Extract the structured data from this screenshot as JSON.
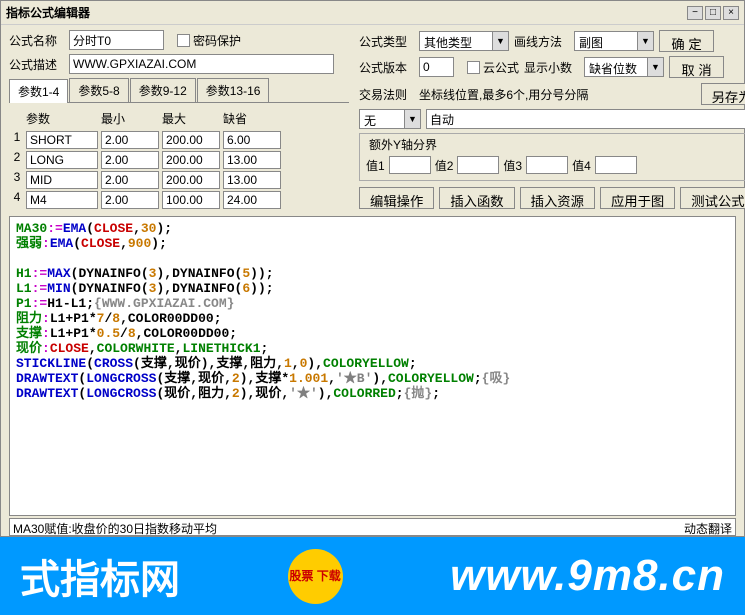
{
  "title": "指标公式编辑器",
  "form": {
    "name_label": "公式名称",
    "name_value": "分时T0",
    "pwd_protect": "密码保护",
    "type_label": "公式类型",
    "type_value": "其他类型",
    "draw_label": "画线方法",
    "draw_value": "副图",
    "desc_label": "公式描述",
    "desc_value": "WWW.GPXIAZAI.COM",
    "ver_label": "公式版本",
    "ver_value": "0",
    "cloud_label": "云公式",
    "decimal_label": "显示小数",
    "decimal_value": "缺省位数"
  },
  "buttons": {
    "ok": "确  定",
    "cancel": "取  消",
    "saveas": "另存为",
    "edit_op": "编辑操作",
    "insert_func": "插入函数",
    "insert_res": "插入资源",
    "apply": "应用于图",
    "test": "测试公式"
  },
  "tabs": [
    "参数1-4",
    "参数5-8",
    "参数9-12",
    "参数13-16"
  ],
  "param_headers": {
    "name": "参数",
    "min": "最小",
    "max": "最大",
    "def": "缺省"
  },
  "params": [
    {
      "n": "1",
      "name": "SHORT",
      "min": "2.00",
      "max": "200.00",
      "def": "6.00"
    },
    {
      "n": "2",
      "name": "LONG",
      "min": "2.00",
      "max": "200.00",
      "def": "13.00"
    },
    {
      "n": "3",
      "name": "MID",
      "min": "2.00",
      "max": "200.00",
      "def": "13.00"
    },
    {
      "n": "4",
      "name": "M4",
      "min": "2.00",
      "max": "100.00",
      "def": "24.00"
    }
  ],
  "trade": {
    "label": "交易法则",
    "coord_label": "坐标线位置,最多6个,用分号分隔",
    "v1": "无",
    "v2": "自动"
  },
  "extra_axis": {
    "title": "额外Y轴分界",
    "v1": "值1",
    "v2": "值2",
    "v3": "值3",
    "v4": "值4"
  },
  "status": "MA30赋值:收盘价的30日指数移动平均",
  "status_right": "动态翻译",
  "banner": {
    "left": "式指标网",
    "logo": "股票\n下载",
    "url": "www.9m8.cn"
  },
  "code": {
    "l1a": "MA30",
    "l1b": ":=",
    "l1c": "EMA",
    "l1d": "CLOSE",
    "l1e": "30",
    "l2a": "强弱",
    "l2b": ":",
    "l2c": "EMA",
    "l2d": "CLOSE",
    "l2e": "900",
    "l3a": "H1",
    "l3b": ":=",
    "l3c": "MAX",
    "l3d": "DYNAINFO",
    "l3e": "3",
    "l3f": "DYNAINFO",
    "l3g": "5",
    "l4a": "L1",
    "l4b": ":=",
    "l4c": "MIN",
    "l4d": "DYNAINFO",
    "l4e": "3",
    "l4f": "DYNAINFO",
    "l4g": "6",
    "l5a": "P1",
    "l5b": ":=",
    "l5c": "H1-L1;",
    "l5d": "{WWW.GPXIAZAI.COM}",
    "l6a": "阻力",
    "l6b": ":",
    "l6c": "L1+P1*",
    "l6d": "7",
    "l6e": "/",
    "l6f": "8",
    "l6g": ",COLOR00DD00;",
    "l7a": "支撑",
    "l7b": ":",
    "l7c": "L1+P1*",
    "l7d": "0.5",
    "l7e": "/",
    "l7f": "8",
    "l7g": ",COLOR00DD00;",
    "l8a": "现价",
    "l8b": ":",
    "l8c": "CLOSE",
    "l8d": ",",
    "l8e": "COLORWHITE",
    "l8f": ",",
    "l8g": "LINETHICK1",
    "l9a": "STICKLINE",
    "l9b": "CROSS",
    "l9c": "支撑",
    "l9d": "现价",
    "l9e": "支撑",
    "l9f": "阻力",
    "l9g": "1",
    "l9h": "0",
    "l9i": "COLORYELLOW",
    "l10a": "DRAWTEXT",
    "l10b": "LONGCROSS",
    "l10c": "支撑",
    "l10d": "现价",
    "l10e": "2",
    "l10f": "支撑*",
    "l10g": "1.001",
    "l10h": "'★B'",
    "l10i": "COLORYELLOW",
    "l10j": "{吸}",
    "l11a": "DRAWTEXT",
    "l11b": "LONGCROSS",
    "l11c": "现价",
    "l11d": "阻力",
    "l11e": "2",
    "l11f": "现价,",
    "l11g": "'★'",
    "l11h": "COLORRED",
    "l11i": "{抛}"
  }
}
